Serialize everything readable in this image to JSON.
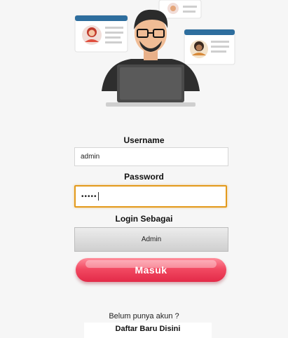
{
  "login": {
    "username_label": "Username",
    "username_value": "admin",
    "password_label": "Password",
    "password_value": "•••••",
    "role_label": "Login Sebagai",
    "role_selected": "Admin",
    "submit_label": "Masuk",
    "register_question": "Belum punya akun ?",
    "register_link": "Daftar Baru Disini"
  },
  "colors": {
    "accent": "#e32a48",
    "focus_border": "#e39a1c",
    "card_blue": "#2e6e9e"
  }
}
